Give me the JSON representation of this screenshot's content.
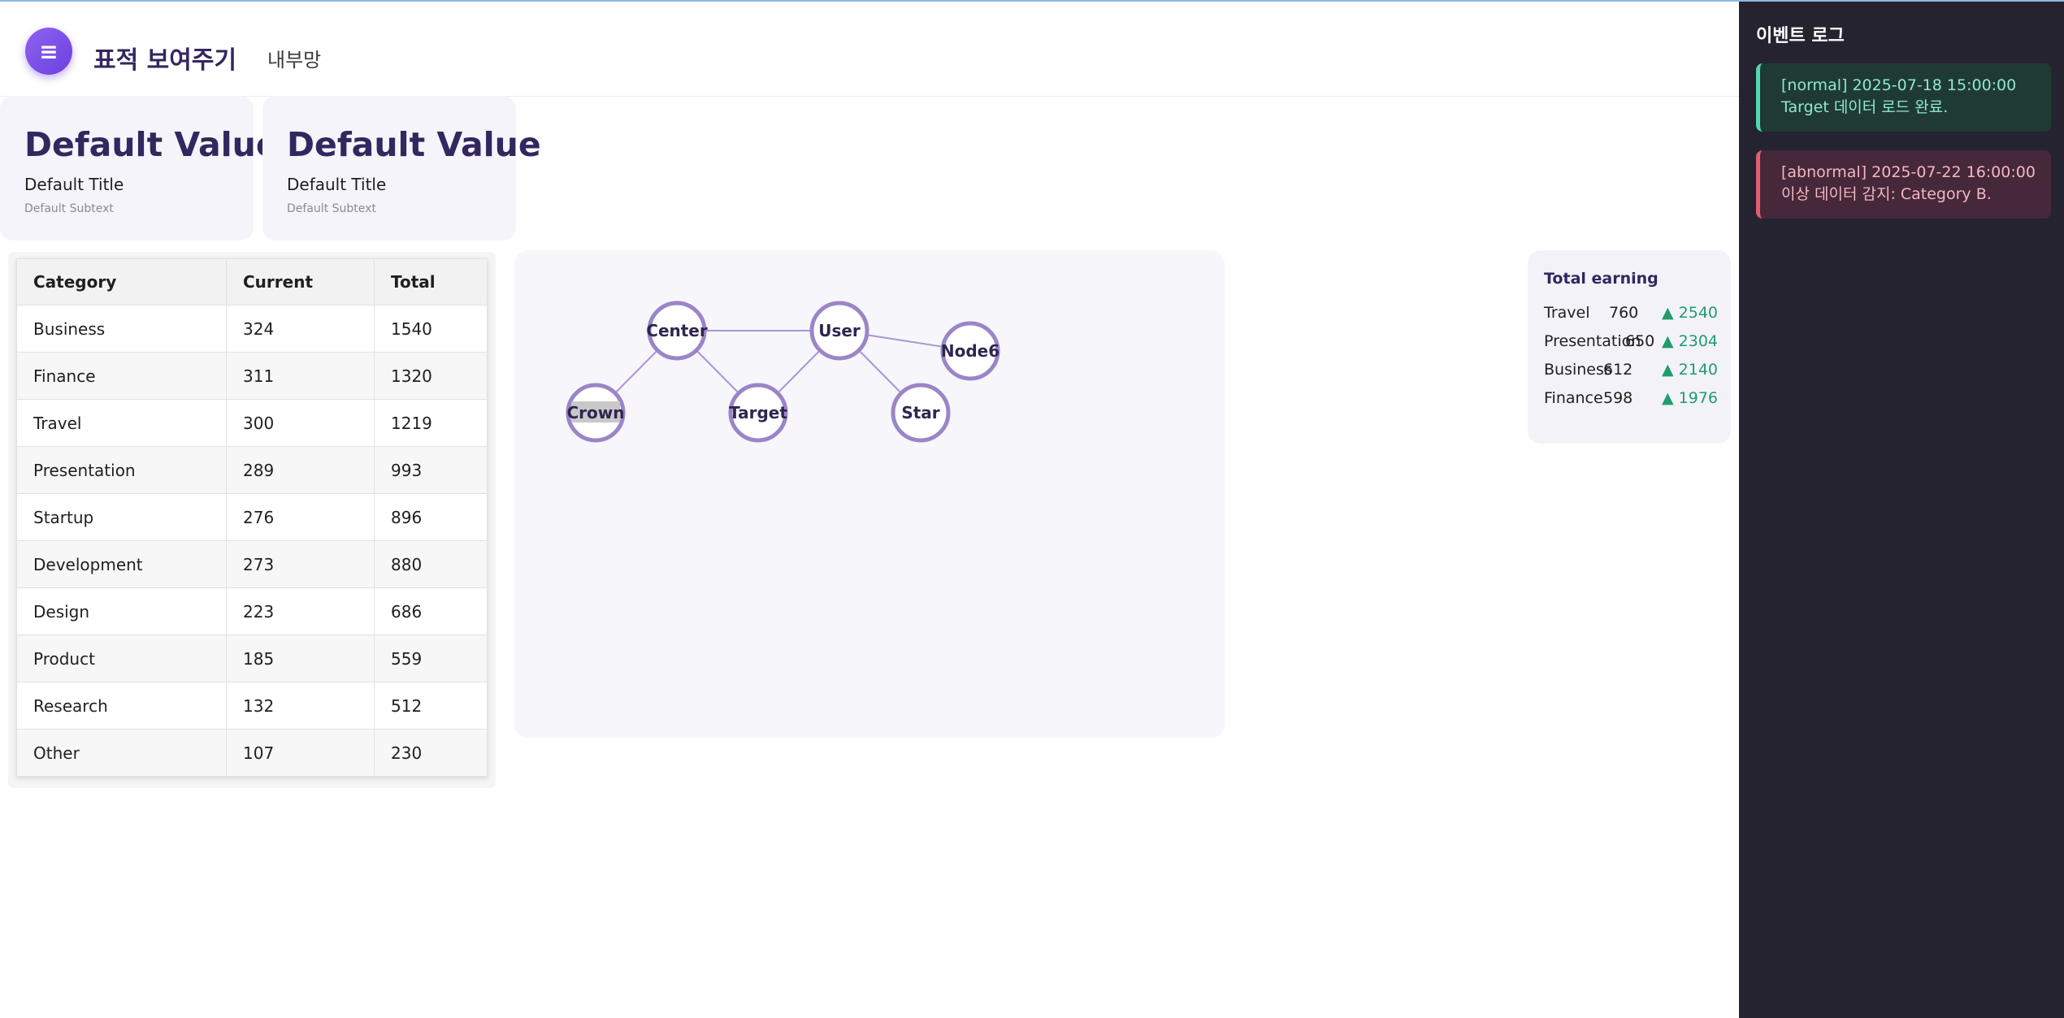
{
  "header": {
    "title": "표적 보여주기",
    "subtitle": "내부망",
    "menu_icon": "≡"
  },
  "cards": [
    {
      "value": "Default Value",
      "title": "Default Title",
      "subtext": "Default Subtext"
    },
    {
      "value": "Default Value",
      "title": "Default Title",
      "subtext": "Default Subtext"
    }
  ],
  "table": {
    "headers": [
      "Category",
      "Current",
      "Total"
    ],
    "rows": [
      [
        "Business",
        "324",
        "1540"
      ],
      [
        "Finance",
        "311",
        "1320"
      ],
      [
        "Travel",
        "300",
        "1219"
      ],
      [
        "Presentation",
        "289",
        "993"
      ],
      [
        "Startup",
        "276",
        "896"
      ],
      [
        "Development",
        "273",
        "880"
      ],
      [
        "Design",
        "223",
        "686"
      ],
      [
        "Product",
        "185",
        "559"
      ],
      [
        "Research",
        "132",
        "512"
      ],
      [
        "Other",
        "107",
        "230"
      ]
    ]
  },
  "network": {
    "nodes": [
      "Center",
      "User",
      "Node6",
      "Crown",
      "Target",
      "Star"
    ],
    "edges": [
      [
        "Center",
        "User"
      ],
      [
        "User",
        "Node6"
      ],
      [
        "Center",
        "Crown"
      ],
      [
        "Center",
        "Target"
      ],
      [
        "User",
        "Target"
      ],
      [
        "User",
        "Star"
      ]
    ],
    "highlighted": "Crown",
    "node_stroke": "#9b85c8",
    "edge_color": "#a995d6"
  },
  "earnings": {
    "title": "Total earning",
    "rows": [
      {
        "category": "Travel",
        "current": "760",
        "total": "2540"
      },
      {
        "category": "Presentation",
        "current": "650",
        "total": "2304"
      },
      {
        "category": "Business",
        "current": "612",
        "total": "2140"
      },
      {
        "category": "Finance",
        "current": "598",
        "total": "1976"
      }
    ],
    "up_color": "#1f9d6c"
  },
  "event_log": {
    "title": "이벤트 로그",
    "entries": [
      {
        "line1": "[normal] 2025-07-18 15:00:00",
        "line2": "Target 데이터 로드 완료."
      },
      {
        "line1": "[abnormal] 2025-07-22 16:00:00",
        "line2": "이상 데이터 감지: Category B."
      }
    ]
  }
}
